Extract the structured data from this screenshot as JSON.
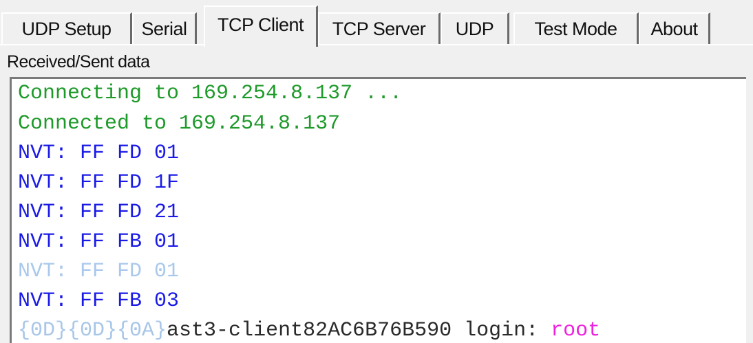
{
  "tabs": [
    {
      "label": "UDP Setup",
      "active": false
    },
    {
      "label": "Serial",
      "active": false
    },
    {
      "label": "TCP Client",
      "active": true
    },
    {
      "label": "TCP Server",
      "active": false
    },
    {
      "label": "UDP",
      "active": false
    },
    {
      "label": "Test Mode",
      "active": false
    },
    {
      "label": "About",
      "active": false
    }
  ],
  "log_group_label": "Received/Sent data",
  "log": [
    {
      "text": "Connecting to 169.254.8.137 ...",
      "color": "#1e9a2a"
    },
    {
      "text": "Connected to 169.254.8.137",
      "color": "#1e9a2a"
    },
    {
      "text": "NVT: FF FD 01",
      "color": "#1a1ae6"
    },
    {
      "text": "NVT: FF FD 1F",
      "color": "#1a1ae6"
    },
    {
      "text": "NVT: FF FD 21",
      "color": "#1a1ae6"
    },
    {
      "text": "NVT: FF FB 01",
      "color": "#1a1ae6"
    },
    {
      "text": "NVT: FF FD 01",
      "color": "#a9c8ec"
    },
    {
      "text": "NVT: FF FB 03",
      "color": "#1a1ae6"
    }
  ],
  "login_line": {
    "prefix": "{0D}{0D}{0A}",
    "prompt": "ast3-client82AC6B76B590 login: ",
    "input": "root",
    "prefix_color": "#a8c6e8",
    "prompt_color": "#2a2a2a",
    "input_color": "#ee22dd"
  }
}
